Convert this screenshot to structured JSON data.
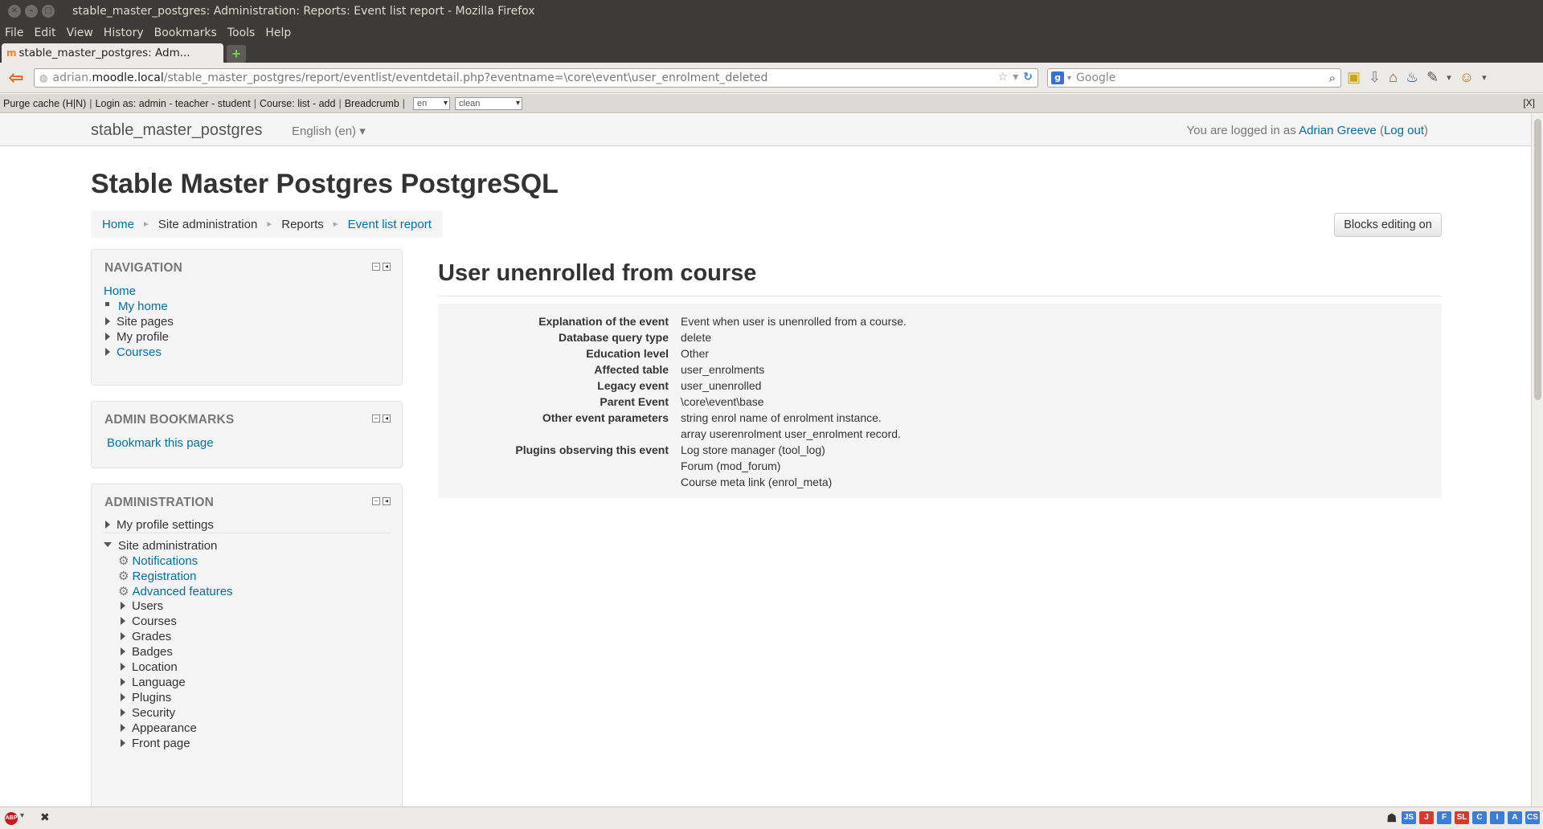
{
  "window": {
    "title": "stable_master_postgres: Administration: Reports: Event list report - Mozilla Firefox"
  },
  "menu": [
    "File",
    "Edit",
    "View",
    "History",
    "Bookmarks",
    "Tools",
    "Help"
  ],
  "tab": {
    "label": "stable_master_postgres: Adm..."
  },
  "url": {
    "host_prefix": "adrian.",
    "host": "moodle.local",
    "path": "/stable_master_postgres/report/eventlist/eventdetail.php?eventname=\\core\\event\\user_enrolment_deleted"
  },
  "search": {
    "placeholder": "Google"
  },
  "devbar": {
    "purge": "Purge cache (H|N)",
    "login_as": "Login as: admin - teacher - student",
    "course": "Course: list - add",
    "breadcrumb": "Breadcrumb",
    "lang_select": "en",
    "theme_select": "clean",
    "close": "[X]"
  },
  "header": {
    "brand": "stable_master_postgres",
    "language": "English (en)",
    "logged_in_prefix": "You are logged in as ",
    "user": "Adrian Greeve",
    "logout": "Log out"
  },
  "site_title": "Stable Master Postgres PostgreSQL",
  "breadcrumb": [
    "Home",
    "Site administration",
    "Reports",
    "Event list report"
  ],
  "blocks_button": "Blocks editing on",
  "navigation": {
    "title": "NAVIGATION",
    "home": "Home",
    "items": [
      "My home",
      "Site pages",
      "My profile",
      "Courses"
    ]
  },
  "admin_bookmarks": {
    "title": "ADMIN BOOKMARKS",
    "link": "Bookmark this page"
  },
  "administration": {
    "title": "ADMINISTRATION",
    "profile_settings": "My profile settings",
    "site_admin": "Site administration",
    "settings_links": [
      "Notifications",
      "Registration",
      "Advanced features"
    ],
    "categories": [
      "Users",
      "Courses",
      "Grades",
      "Badges",
      "Location",
      "Language",
      "Plugins",
      "Security",
      "Appearance",
      "Front page"
    ]
  },
  "main": {
    "heading": "User unenrolled from course",
    "details": [
      {
        "label": "Explanation of the event",
        "values": [
          "Event when user is unenrolled from a course."
        ]
      },
      {
        "label": "Database query type",
        "values": [
          "delete"
        ]
      },
      {
        "label": "Education level",
        "values": [
          "Other"
        ]
      },
      {
        "label": "Affected table",
        "values": [
          "user_enrolments"
        ]
      },
      {
        "label": "Legacy event",
        "values": [
          "user_unenrolled"
        ]
      },
      {
        "label": "Parent Event",
        "values": [
          "\\core\\event\\base"
        ]
      },
      {
        "label": "Other event parameters",
        "values": [
          "string enrol name of enrolment instance.",
          "array userenrolment user_enrolment record."
        ]
      },
      {
        "label": "Plugins observing this event",
        "values": [
          "Log store manager (tool_log)",
          "Forum (mod_forum)",
          "Course meta link (enrol_meta)"
        ]
      }
    ]
  },
  "statusbar": {
    "addons": [
      "JS",
      "J",
      "F",
      "SL",
      "C",
      "I",
      "A",
      "CS"
    ],
    "addon_colors": [
      "#3b7dd8",
      "#d9382d",
      "#3b7dd8",
      "#d9382d",
      "#3b7dd8",
      "#3b7dd8",
      "#3b7dd8",
      "#3b7dd8"
    ]
  },
  "colors": {
    "link": "#0070a8",
    "accent": "#f58220"
  }
}
